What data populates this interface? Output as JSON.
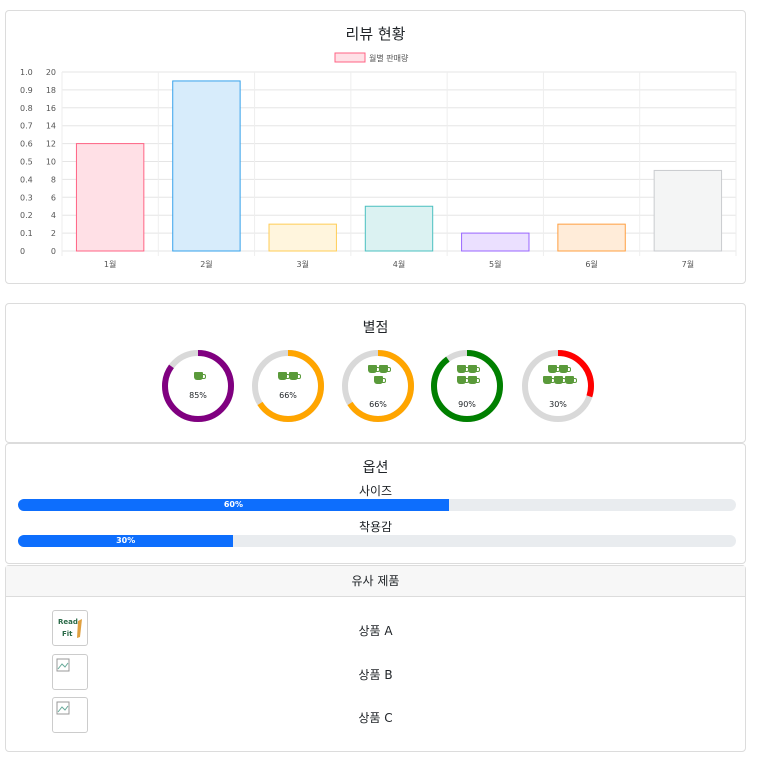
{
  "review_chart": {
    "title": "리뷰 현황",
    "chart_data": {
      "type": "bar",
      "title": "리뷰 현황",
      "categories": [
        "1월",
        "2월",
        "3월",
        "4월",
        "5월",
        "6월",
        "7월"
      ],
      "series": [
        {
          "name": "월별 판매량",
          "values": [
            12,
            19,
            3,
            5,
            2,
            3,
            9
          ]
        }
      ],
      "ylim": [
        0,
        20
      ],
      "y_ticks": [
        0,
        2,
        4,
        6,
        8,
        10,
        12,
        14,
        16,
        18,
        20
      ],
      "y_ticks_secondary": [
        "0",
        "0.1",
        "0.2",
        "0.3",
        "0.4",
        "0.5",
        "0.6",
        "0.7",
        "0.8",
        "0.9",
        "1.0"
      ],
      "bar_fill_colors": [
        "#ffe0e6",
        "#d7ecfb",
        "#fff5dd",
        "#dbf2f2",
        "#ebe0ff",
        "#ffecd9",
        "#f4f5f5"
      ],
      "bar_border_colors": [
        "#ff6384",
        "#36a2eb",
        "#ffcd56",
        "#4bc0c0",
        "#9966ff",
        "#ff9f40",
        "#c9cbcf"
      ],
      "grid": true,
      "legend": "top"
    }
  },
  "star_rating": {
    "title": "별점",
    "rings": [
      {
        "cups": 1,
        "percent": 85,
        "percent_text": "85%",
        "color": "#800080"
      },
      {
        "cups": 2,
        "percent": 66,
        "percent_text": "66%",
        "color": "#ffa500"
      },
      {
        "cups": 3,
        "percent": 66,
        "percent_text": "66%",
        "color": "#ffa500"
      },
      {
        "cups": 4,
        "percent": 90,
        "percent_text": "90%",
        "color": "#008000"
      },
      {
        "cups": 5,
        "percent": 30,
        "percent_text": "30%",
        "color": "#ff0000"
      }
    ],
    "track_color": "#d9d9d9"
  },
  "options": {
    "title": "옵션",
    "bars": [
      {
        "label": "사이즈",
        "percent": 60,
        "percent_text": "60%"
      },
      {
        "label": "착용감",
        "percent": 30,
        "percent_text": "30%"
      }
    ],
    "accent": "#0d6efd"
  },
  "similar_products": {
    "title": "유사 제품",
    "items": [
      {
        "name": "상품 A",
        "logo_text": "Read Fit"
      },
      {
        "name": "상품 B"
      },
      {
        "name": "상품 C"
      }
    ]
  }
}
